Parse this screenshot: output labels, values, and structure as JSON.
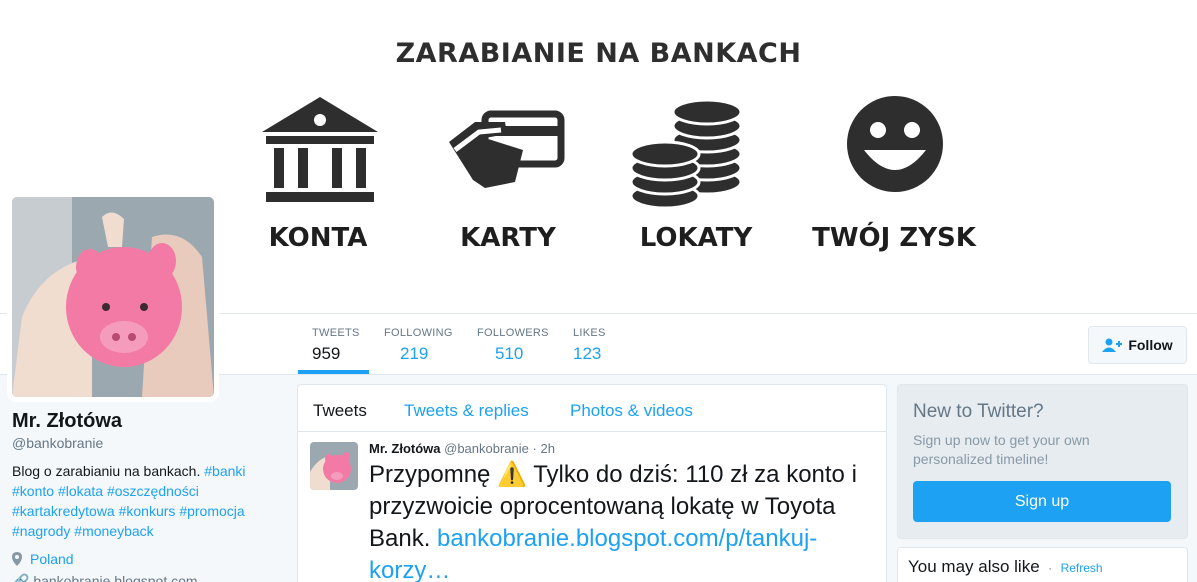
{
  "banner": {
    "title": "ZARABIANIE NA BANKACH",
    "items": [
      {
        "label": "KONTA",
        "icon": "bank-icon"
      },
      {
        "label": "KARTY",
        "icon": "card-hand-icon"
      },
      {
        "label": "LOKATY",
        "icon": "coins-icon"
      },
      {
        "label": "TWÓJ ZYSK",
        "icon": "smiley-icon"
      }
    ]
  },
  "stats": [
    {
      "label": "TWEETS",
      "value": "959"
    },
    {
      "label": "FOLLOWING",
      "value": "219"
    },
    {
      "label": "FOLLOWERS",
      "value": "510"
    },
    {
      "label": "LIKES",
      "value": "123"
    }
  ],
  "follow_label": "Follow",
  "profile": {
    "name": "Mr. Złotówa",
    "handle": "@bankobranie",
    "bio_text": "Blog o zarabianiu na bankach.",
    "bio_tags": [
      "#banki",
      "#konto",
      "#lokata",
      "#oszczędności",
      "#kartakredytowa",
      "#konkurs",
      "#promocja",
      "#nagrody",
      "#moneyback"
    ],
    "location": "Poland",
    "link_partial": "bankobranie.blogspot.com"
  },
  "timeline": {
    "tabs": [
      "Tweets",
      "Tweets & replies",
      "Photos & videos"
    ],
    "tweet": {
      "name": "Mr. Złotówa",
      "handle": "@bankobranie",
      "sep": "·",
      "time": "2h",
      "text_before": "Przypomnę",
      "warning_icon": "⚠️",
      "text_after": "Tylko do dziś: 110 zł za konto i przyzwoicie oprocentowaną lokatę w Toyota Bank.",
      "link": "bankobranie.blogspot.com/p/tankuj-korzy…"
    }
  },
  "signup": {
    "title": "New to Twitter?",
    "text": "Sign up now to get your own personalized timeline!",
    "button": "Sign up"
  },
  "also_like": {
    "title": "You may also like",
    "sep": "·",
    "refresh": "Refresh"
  },
  "colors": {
    "accent": "#1da1f2",
    "muted": "#657786",
    "background": "#f5f8fa",
    "piggy": "#f27aa4"
  }
}
